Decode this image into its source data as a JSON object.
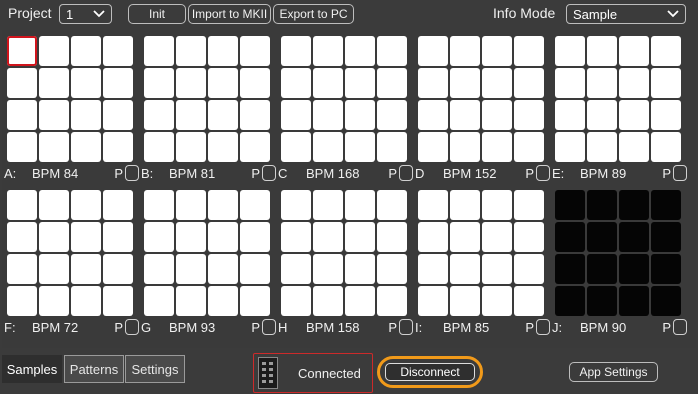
{
  "topbar": {
    "project_label": "Project",
    "project_value": "1",
    "init_label": "Init",
    "import_label": "Import to MKII",
    "export_label": "Export to PC",
    "info_mode_label": "Info Mode",
    "info_mode_value": "Sample"
  },
  "banks": [
    {
      "letter": "A:",
      "bpm": "BPM 84",
      "p": "P",
      "active": true,
      "selected_pad": 0
    },
    {
      "letter": "B:",
      "bpm": "BPM 81",
      "p": "P",
      "active": true
    },
    {
      "letter": "C",
      "bpm": "BPM 168",
      "p": "P",
      "active": true
    },
    {
      "letter": "D",
      "bpm": "BPM 152",
      "p": "P",
      "active": true
    },
    {
      "letter": "E:",
      "bpm": "BPM 89",
      "p": "P",
      "active": true
    },
    {
      "letter": "F:",
      "bpm": "BPM 72",
      "p": "P",
      "active": true
    },
    {
      "letter": "G",
      "bpm": "BPM 93",
      "p": "P",
      "active": true
    },
    {
      "letter": "H",
      "bpm": "BPM 158",
      "p": "P",
      "active": true
    },
    {
      "letter": "I:",
      "bpm": "BPM 85",
      "p": "P",
      "active": true
    },
    {
      "letter": "J:",
      "bpm": "BPM 90",
      "p": "P",
      "active": false
    }
  ],
  "tabs": {
    "samples": "Samples",
    "patterns": "Patterns",
    "settings": "Settings",
    "active": "samples"
  },
  "connection": {
    "status": "Connected",
    "disconnect_label": "Disconnect",
    "app_settings_label": "App Settings"
  },
  "colors": {
    "accent_orange": "#f19a1a",
    "selected_pad_red": "#d0141c",
    "connected_border_red": "#cc2a2a"
  },
  "icons": {
    "dropdown": "chevron-down-icon",
    "device": "device-thumbnail"
  }
}
